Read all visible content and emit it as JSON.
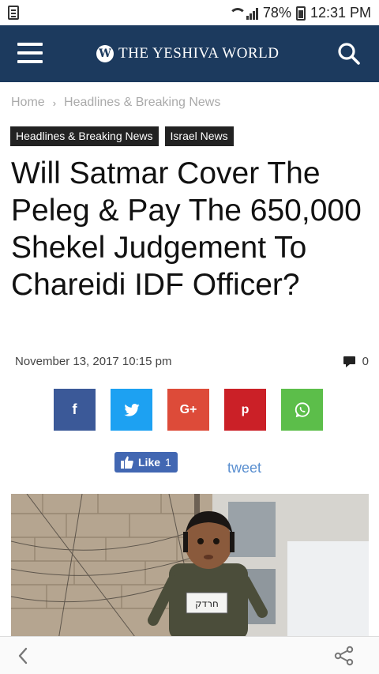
{
  "status_bar": {
    "battery": "78%",
    "time": "12:31 PM"
  },
  "header": {
    "site_name": "THE YESHIVA WORLD",
    "logo_glyph": "W",
    "menu_icon": "hamburger-icon",
    "search_icon": "search-icon",
    "background": "#1c3a5e"
  },
  "breadcrumb": {
    "items": [
      "Home",
      "Headlines & Breaking News"
    ],
    "separator": "›"
  },
  "categories": [
    "Headlines & Breaking News",
    "Israel News"
  ],
  "article": {
    "title": "Will Satmar Cover The Peleg & Pay The 650,000 Shekel Judgement To Chareidi IDF Officer?",
    "date": "November 13, 2017 10:15 pm",
    "comment_count": "0"
  },
  "share_buttons": {
    "facebook": "f",
    "twitter_icon": "twitter-bird-icon",
    "googleplus": "G+",
    "pinterest": "p",
    "whatsapp_icon": "whatsapp-icon",
    "colors": [
      "#3b5998",
      "#1da1f2",
      "#dd4b39",
      "#cb2027",
      "#5cbe4a"
    ]
  },
  "social": {
    "like_label": "Like",
    "like_count": "1",
    "tweet_label": "tweet"
  },
  "hero_image": {
    "sign_text": "חרדק"
  },
  "bottom_nav": {
    "back_icon": "back-chevron-icon",
    "share_icon": "share-icon"
  }
}
